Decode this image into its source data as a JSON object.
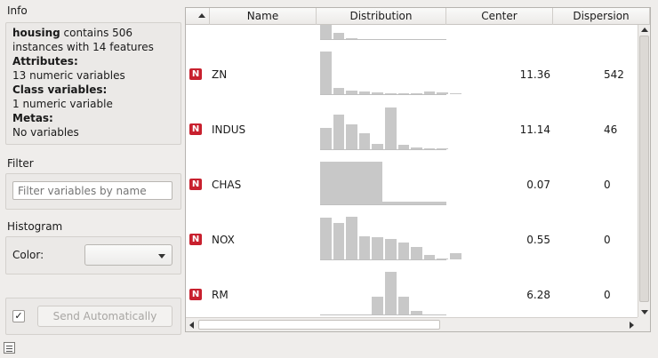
{
  "info": {
    "title": "Info",
    "dataset": "housing",
    "summary": " contains 506 instances with 14 features",
    "attributes_label": "Attributes:",
    "attributes_value": "13 numeric variables",
    "class_label": "Class variables:",
    "class_value": "1 numeric variable",
    "metas_label": "Metas:",
    "metas_value": "No variables"
  },
  "filter": {
    "title": "Filter",
    "placeholder": "Filter variables by name"
  },
  "histogram": {
    "title": "Histogram",
    "color_label": "Color:",
    "color_value": ""
  },
  "send": {
    "checked": true,
    "check_mark": "✓",
    "button_label": "Send Automatically"
  },
  "table": {
    "columns": [
      "",
      "Name",
      "Distribution",
      "Center",
      "Dispersion"
    ],
    "bar_color": "#c8c8c8",
    "badge_color": "#c8202e",
    "badge_text": "N",
    "rows": [
      {
        "name": "",
        "center": "",
        "dispersion": "",
        "hist": [
          0.95,
          0.15,
          0.03
        ]
      },
      {
        "name": "ZN",
        "center": "11.36",
        "dispersion": "542",
        "hist": [
          1.0,
          0.15,
          0.08,
          0.06,
          0.04,
          0.03,
          0.02,
          0.02,
          0.06,
          0.04,
          0.03
        ]
      },
      {
        "name": "INDUS",
        "center": "11.14",
        "dispersion": "46",
        "hist": [
          0.5,
          0.82,
          0.58,
          0.37,
          0.12,
          0.98,
          0.1,
          0.05,
          0.03,
          0.02
        ]
      },
      {
        "name": "CHAS",
        "center": "0.07",
        "dispersion": "0",
        "hist": [
          1.0,
          0.07
        ]
      },
      {
        "name": "NOX",
        "center": "0.55",
        "dispersion": "0",
        "hist": [
          0.97,
          0.85,
          1.0,
          0.55,
          0.52,
          0.47,
          0.4,
          0.3,
          0.1,
          0.03,
          0.15
        ]
      },
      {
        "name": "RM",
        "center": "6.28",
        "dispersion": "0",
        "hist": [
          0.0,
          0.0,
          0.0,
          0.0,
          0.42,
          1.0,
          0.42,
          0.08
        ]
      }
    ]
  }
}
